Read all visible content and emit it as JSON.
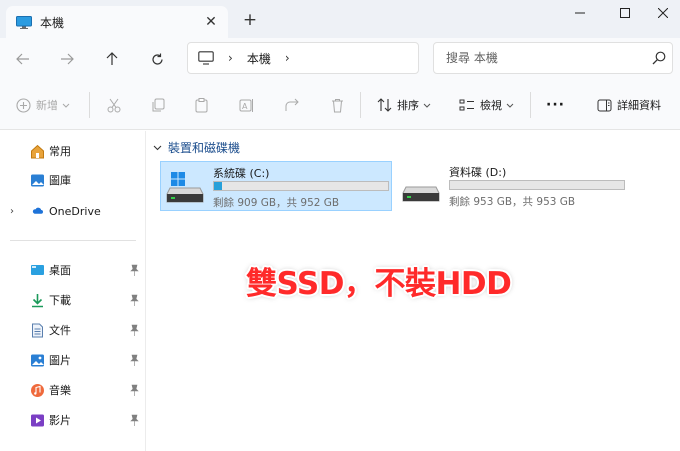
{
  "tab": {
    "title": "本機",
    "close": "✕"
  },
  "new_tab": "+",
  "address": {
    "crumb": "本機",
    "sep": "›"
  },
  "search": {
    "placeholder": "搜尋 本機"
  },
  "commands": {
    "new": "新增",
    "sort": "排序",
    "view": "檢視",
    "more": "···",
    "details": "詳細資料"
  },
  "sidebar": {
    "items": [
      {
        "label": "常用",
        "icon": "home-icon"
      },
      {
        "label": "圖庫",
        "icon": "gallery-icon"
      },
      {
        "label": "OneDrive",
        "icon": "cloud-icon"
      },
      {
        "label": "桌面",
        "icon": "desktop-icon"
      },
      {
        "label": "下載",
        "icon": "download-icon"
      },
      {
        "label": "文件",
        "icon": "document-icon"
      },
      {
        "label": "圖片",
        "icon": "picture-icon"
      },
      {
        "label": "音樂",
        "icon": "music-icon"
      },
      {
        "label": "影片",
        "icon": "video-icon"
      }
    ]
  },
  "group": {
    "title": "裝置和磁碟機"
  },
  "drives": [
    {
      "name": "系統碟 (C:)",
      "size": "剩餘 909 GB，共 952 GB",
      "used_fraction": 0.045,
      "selected": true
    },
    {
      "name": "資料碟 (D:)",
      "size": "剩餘 953 GB，共 953 GB",
      "used_fraction": 0.0,
      "selected": false
    }
  ],
  "overlay": {
    "text": "雙SSD，不裝HDD"
  },
  "colors": {
    "accent": "#26a0da",
    "selection": "#cce8ff",
    "overlay": "#ff2a2a"
  }
}
